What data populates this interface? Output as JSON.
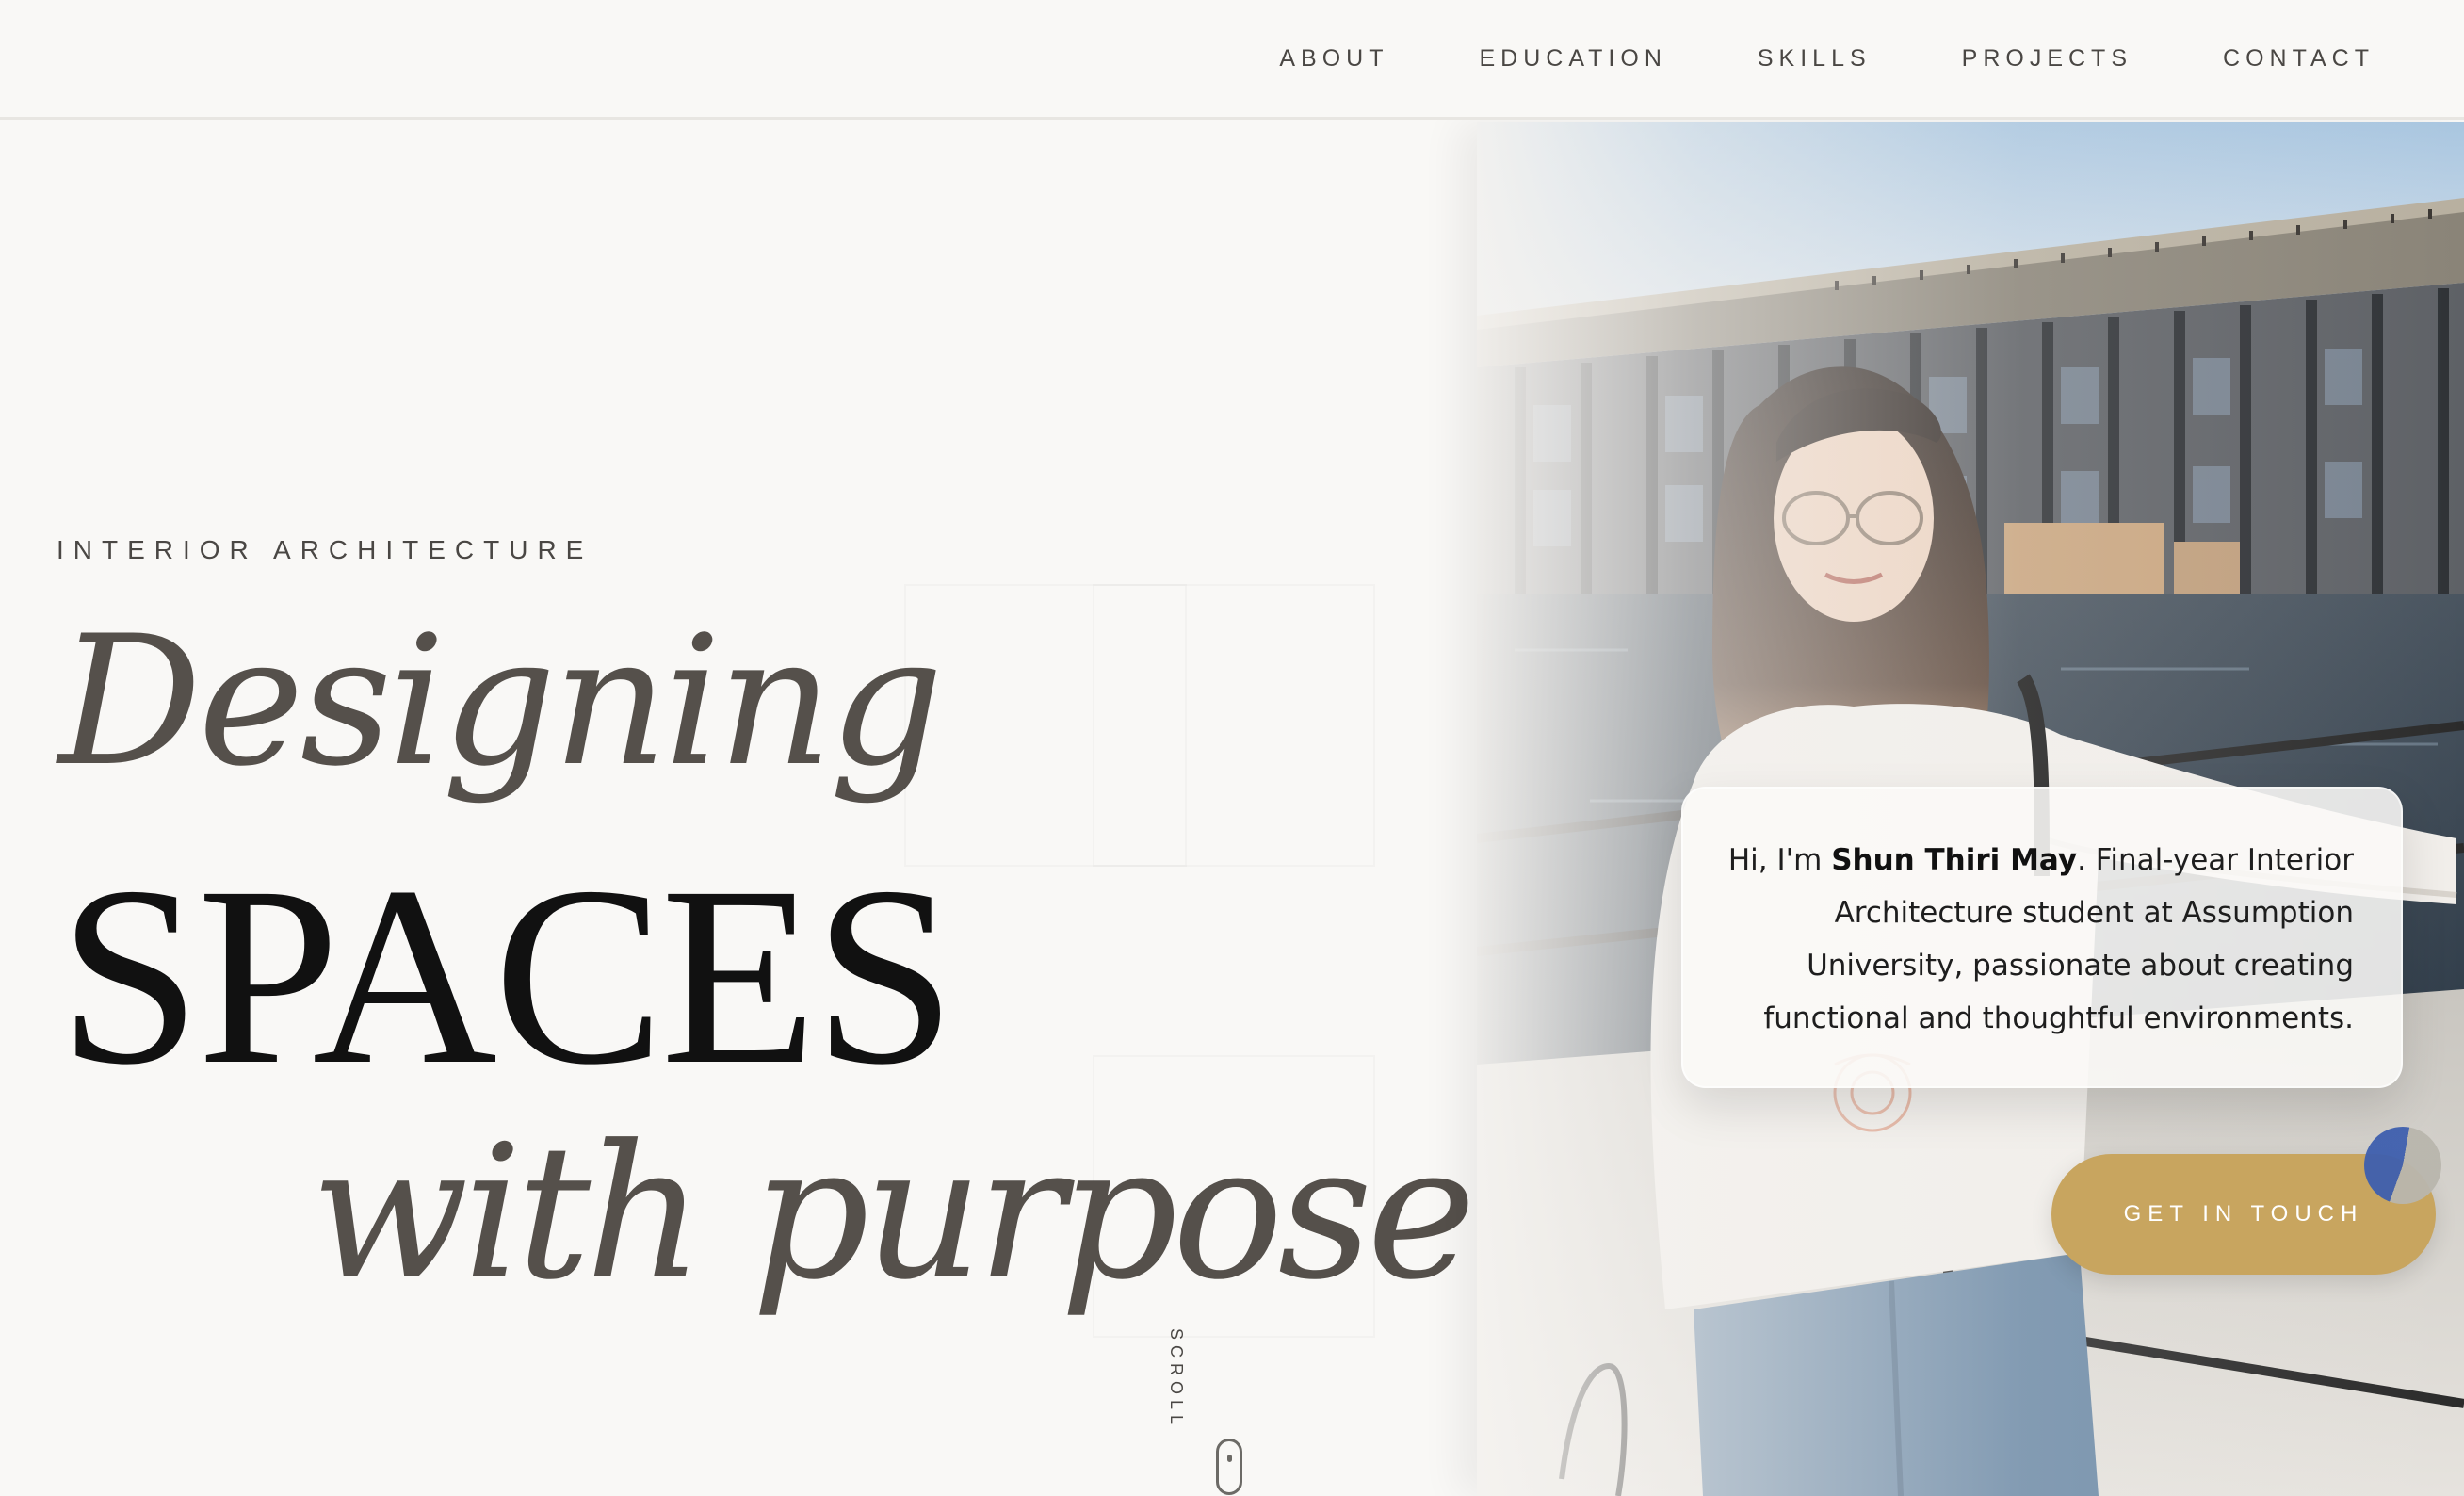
{
  "nav": {
    "links": [
      "ABOUT",
      "EDUCATION",
      "SKILLS",
      "PROJECTS",
      "CONTACT"
    ]
  },
  "hero": {
    "eyebrow": "INTERIOR ARCHITECTURE",
    "line1": "Designing",
    "line2": "SPACES",
    "line3": "with purpose.",
    "scroll_label": "SCROLL"
  },
  "intro": {
    "prefix": "Hi, I'm ",
    "name": "Shun Thiri May",
    "rest": ". Final-year Interior Architecture student at Assumption University, passionate about creating functional and thoughtful environments."
  },
  "cta": {
    "label": "GET IN TOUCH"
  },
  "colors": {
    "background": "#f9f8f6",
    "accent_gold": "#c8a55f",
    "headline_dark": "#111111",
    "headline_muted": "#55504b"
  },
  "icons": {
    "scroll": "mouse-scroll-icon"
  }
}
